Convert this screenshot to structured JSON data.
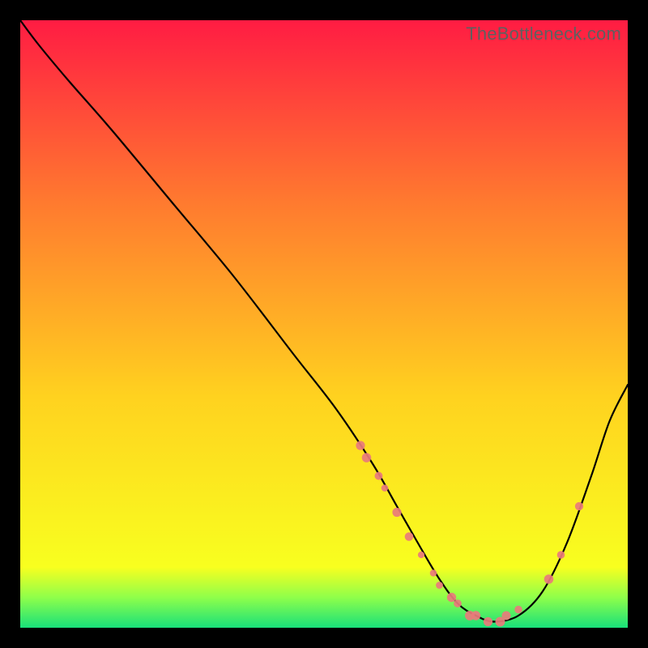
{
  "watermark": "TheBottleneck.com",
  "colors": {
    "gradient_top": "#ff1c43",
    "gradient_mid1": "#ff7a2f",
    "gradient_mid2": "#ffd21f",
    "gradient_mid3": "#f8ff1f",
    "gradient_bottom_band_top": "#8fff4a",
    "gradient_bottom_band_bottom": "#18e07a",
    "curve": "#000000",
    "dots": "#e97b7b"
  },
  "chart_data": {
    "type": "line",
    "title": "",
    "xlabel": "",
    "ylabel": "",
    "xlim": [
      0,
      100
    ],
    "ylim": [
      0,
      100
    ],
    "grid": false,
    "legend": false,
    "series": [
      {
        "name": "bottleneck-curve",
        "x": [
          0,
          3,
          8,
          15,
          25,
          35,
          45,
          52,
          58,
          62,
          66,
          69,
          72,
          75,
          78,
          82,
          86,
          90,
          94,
          97,
          100
        ],
        "y": [
          100,
          96,
          90,
          82,
          70,
          58,
          45,
          36,
          27,
          20,
          13,
          8,
          4,
          2,
          1,
          2,
          6,
          14,
          25,
          34,
          40
        ]
      }
    ],
    "scatter_points": {
      "name": "highlighted-points",
      "x": [
        56,
        57,
        59,
        60,
        62,
        64,
        66,
        68,
        69,
        71,
        72,
        74,
        75,
        77,
        79,
        80,
        82,
        87,
        89,
        92
      ],
      "y": [
        30,
        28,
        25,
        23,
        19,
        15,
        12,
        9,
        7,
        5,
        4,
        2,
        2,
        1,
        1,
        2,
        3,
        8,
        12,
        20
      ]
    }
  }
}
